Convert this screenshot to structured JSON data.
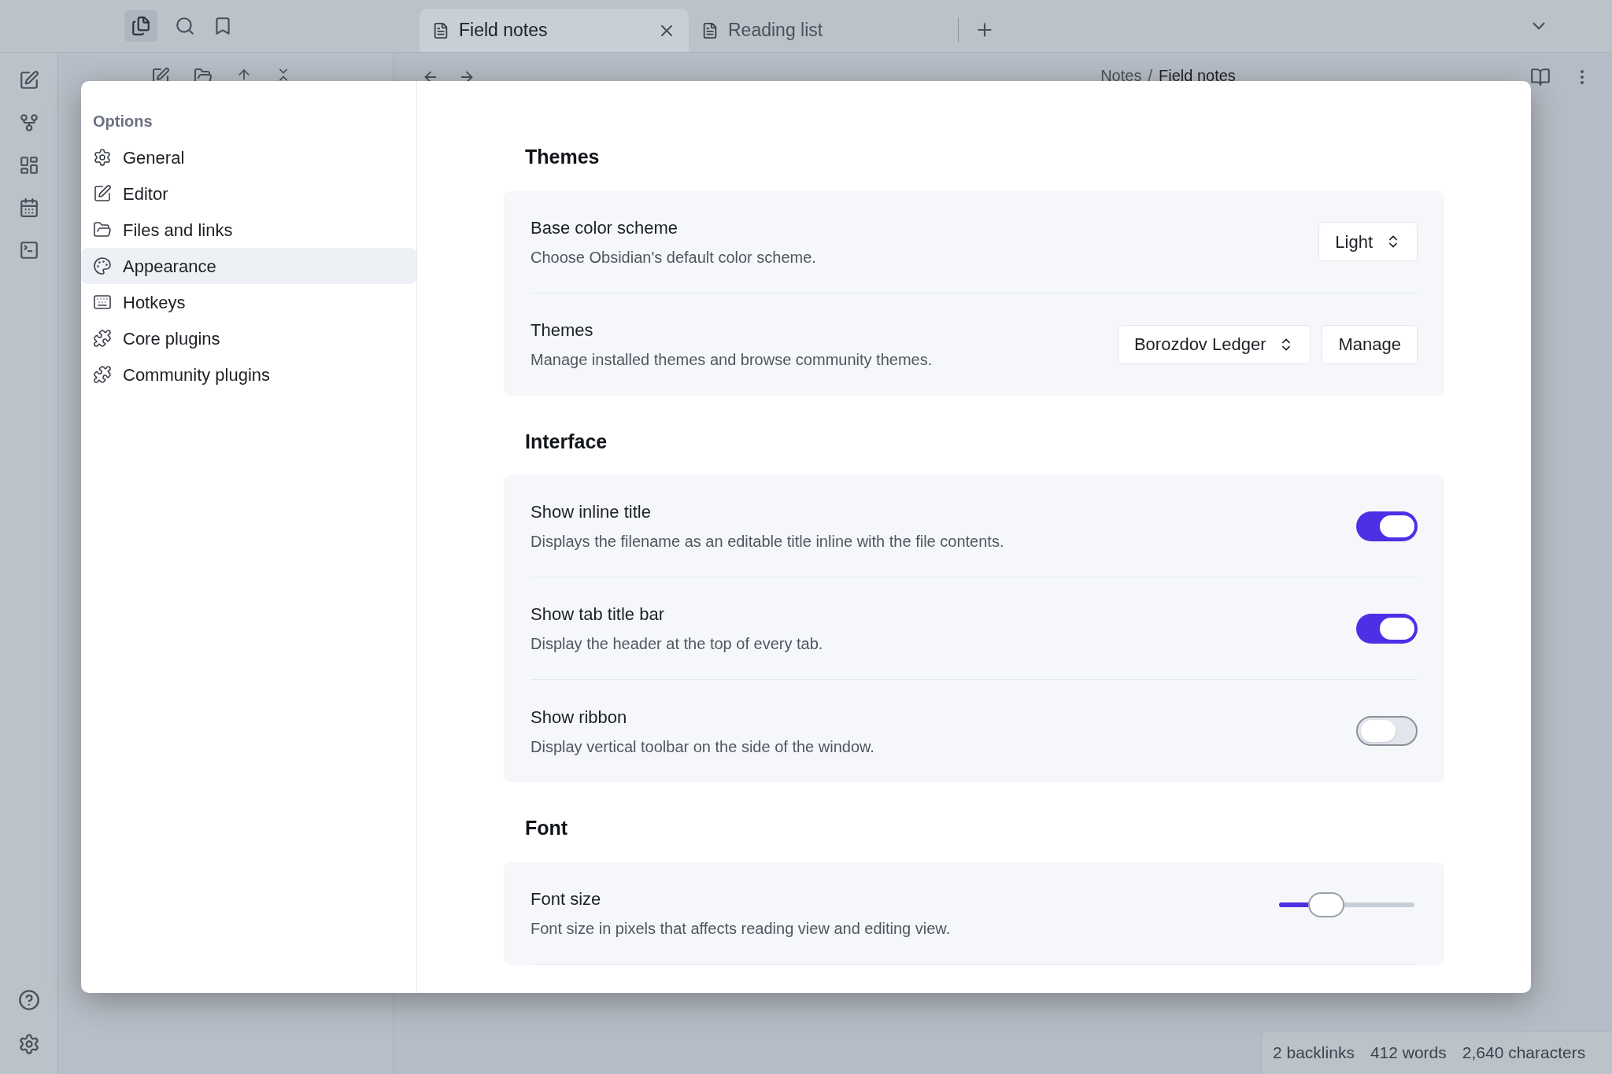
{
  "tabs": [
    {
      "label": "Field notes",
      "selected": true
    },
    {
      "label": "Reading list",
      "selected": false
    }
  ],
  "breadcrumb": {
    "folder": "Notes",
    "separator": "/",
    "file": "Field notes"
  },
  "settings": {
    "sidebar_title": "Options",
    "items": [
      {
        "label": "General",
        "selected": false
      },
      {
        "label": "Editor",
        "selected": false
      },
      {
        "label": "Files and links",
        "selected": false
      },
      {
        "label": "Appearance",
        "selected": true
      },
      {
        "label": "Hotkeys",
        "selected": false
      },
      {
        "label": "Core plugins",
        "selected": false
      },
      {
        "label": "Community plugins",
        "selected": false
      }
    ],
    "sections": [
      {
        "title": "Themes",
        "rows": [
          {
            "kind": "select",
            "name": "Base color scheme",
            "description": "Choose Obsidian's default color scheme.",
            "value": "Light"
          },
          {
            "kind": "select",
            "name": "Themes",
            "description": "Manage installed themes and browse community themes.",
            "value": "Borozdov Ledger",
            "button": "Manage"
          }
        ]
      },
      {
        "title": "Interface",
        "rows": [
          {
            "kind": "toggle",
            "name": "Show inline title",
            "description": "Displays the filename as an editable title inline with the file contents.",
            "on": true
          },
          {
            "kind": "toggle",
            "name": "Show tab title bar",
            "description": "Display the header at the top of every tab.",
            "on": true
          },
          {
            "kind": "toggle",
            "name": "Show ribbon",
            "description": "Display vertical toolbar on the side of the window.",
            "on": false
          }
        ]
      },
      {
        "title": "Font",
        "rows": [
          {
            "kind": "slider",
            "name": "Font size",
            "description": "Font size in pixels that affects reading view and editing view.",
            "level": 0.35
          }
        ]
      }
    ]
  },
  "status_bar": [
    "2 backlinks",
    "412 words",
    "2,640 characters"
  ]
}
